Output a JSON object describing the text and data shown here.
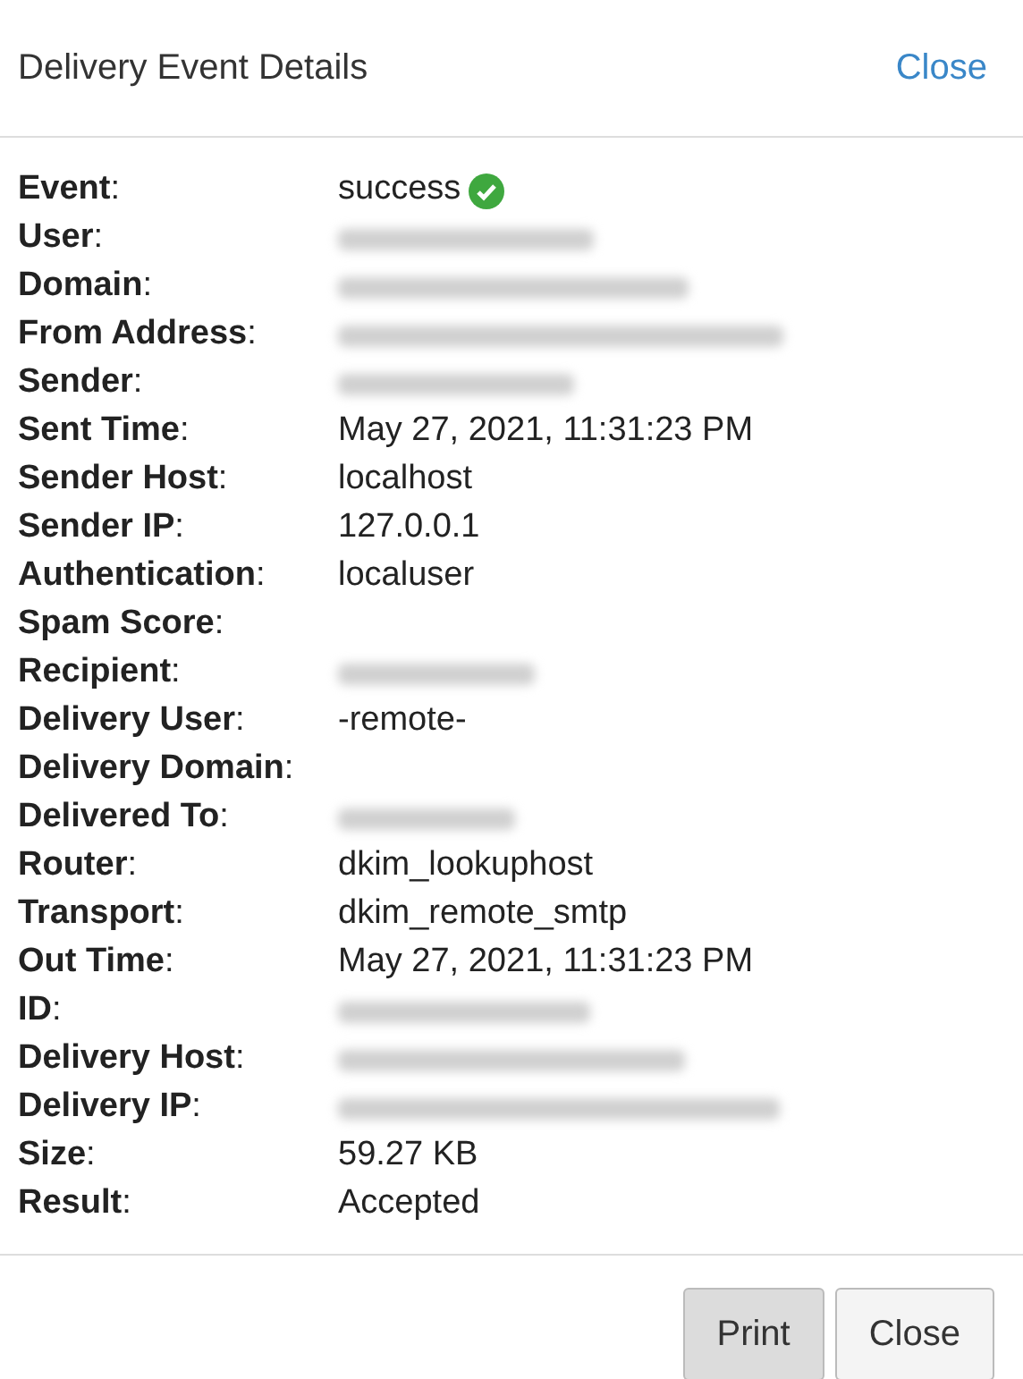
{
  "header": {
    "title": "Delivery Event Details",
    "close_link": "Close"
  },
  "fields": [
    {
      "label": "**Event**:",
      "kind": "status",
      "value": "success"
    },
    {
      "label": "**User**:",
      "kind": "redacted"
    },
    {
      "label": "**Domain**:",
      "kind": "redacted"
    },
    {
      "label": "**From Address**:",
      "kind": "redacted"
    },
    {
      "label": "**Sender**:",
      "kind": "redacted"
    },
    {
      "label": "**Sent Time**:",
      "kind": "text",
      "value": "May 27, 2021, 11:31:23 PM"
    },
    {
      "label": "**Sender Host**:",
      "kind": "text",
      "value": "localhost"
    },
    {
      "label": "**Sender IP**:",
      "kind": "text",
      "value": "127.0.0.1"
    },
    {
      "label": "**Authentication**:",
      "kind": "text",
      "value": "localuser"
    },
    {
      "label": "**Spam Score**:",
      "kind": "empty"
    },
    {
      "label": "**Recipient**:",
      "kind": "redacted"
    },
    {
      "label": "**Delivery User**:",
      "kind": "text",
      "value": "-remote-"
    },
    {
      "label": "**Delivery Domain**:",
      "kind": "empty"
    },
    {
      "label": "**Delivered To**:",
      "kind": "redacted"
    },
    {
      "label": "**Router**:",
      "kind": "text",
      "value": "dkim_lookuphost"
    },
    {
      "label": "**Transport**:",
      "kind": "text",
      "value": "dkim_remote_smtp"
    },
    {
      "label": "**Out Time**:",
      "kind": "text",
      "value": "May 27, 2021, 11:31:23 PM"
    },
    {
      "label": "**ID**:",
      "kind": "redacted"
    },
    {
      "label": "**Delivery Host**:",
      "kind": "redacted"
    },
    {
      "label": "**Delivery IP**:",
      "kind": "redacted"
    },
    {
      "label": "**Size**:",
      "kind": "text",
      "value": "59.27 KB"
    },
    {
      "label": "**Result**:",
      "kind": "text",
      "value": "Accepted"
    }
  ],
  "buttons": [
    {
      "label": "Print",
      "selected": true
    },
    {
      "label": "Close",
      "selected": false
    }
  ]
}
